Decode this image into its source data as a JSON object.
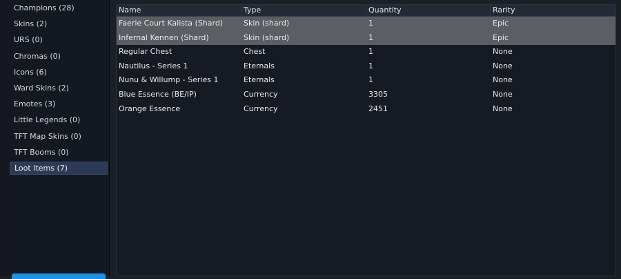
{
  "sidebar": {
    "items": [
      {
        "label": "Champions (28)",
        "selected": false
      },
      {
        "label": "Skins (2)",
        "selected": false
      },
      {
        "label": "URS (0)",
        "selected": false
      },
      {
        "label": "Chromas (0)",
        "selected": false
      },
      {
        "label": "Icons (6)",
        "selected": false
      },
      {
        "label": "Ward Skins (2)",
        "selected": false
      },
      {
        "label": "Emotes (3)",
        "selected": false
      },
      {
        "label": "Little Legends (0)",
        "selected": false
      },
      {
        "label": "TFT Map Skins (0)",
        "selected": false
      },
      {
        "label": "TFT Booms (0)",
        "selected": false
      },
      {
        "label": "Loot Items (7)",
        "selected": true
      }
    ]
  },
  "table": {
    "columns": [
      "Name",
      "Type",
      "Quantity",
      "Rarity"
    ],
    "rows": [
      {
        "name": "Faerie Court Kalista (Shard)",
        "type": "Skin (shard)",
        "quantity": "1",
        "rarity": "Epic",
        "selected": true
      },
      {
        "name": "Infernal Kennen (Shard)",
        "type": "Skin (shard)",
        "quantity": "1",
        "rarity": "Epic",
        "selected": true
      },
      {
        "name": "Regular Chest",
        "type": "Chest",
        "quantity": "1",
        "rarity": "None",
        "selected": false
      },
      {
        "name": "Nautilus - Series 1",
        "type": "Eternals",
        "quantity": "1",
        "rarity": "None",
        "selected": false
      },
      {
        "name": "Nunu & Willump - Series 1",
        "type": "Eternals",
        "quantity": "1",
        "rarity": "None",
        "selected": false
      },
      {
        "name": "Blue Essence (BE/IP)",
        "type": "Currency",
        "quantity": "3305",
        "rarity": "None",
        "selected": false
      },
      {
        "name": "Orange Essence",
        "type": "Currency",
        "quantity": "2451",
        "rarity": "None",
        "selected": false
      }
    ]
  },
  "colors": {
    "selected_row_bg": "#5b5e62",
    "selected_sidebar_bg": "#2d3a55",
    "accent_button": "#1e90e6"
  }
}
